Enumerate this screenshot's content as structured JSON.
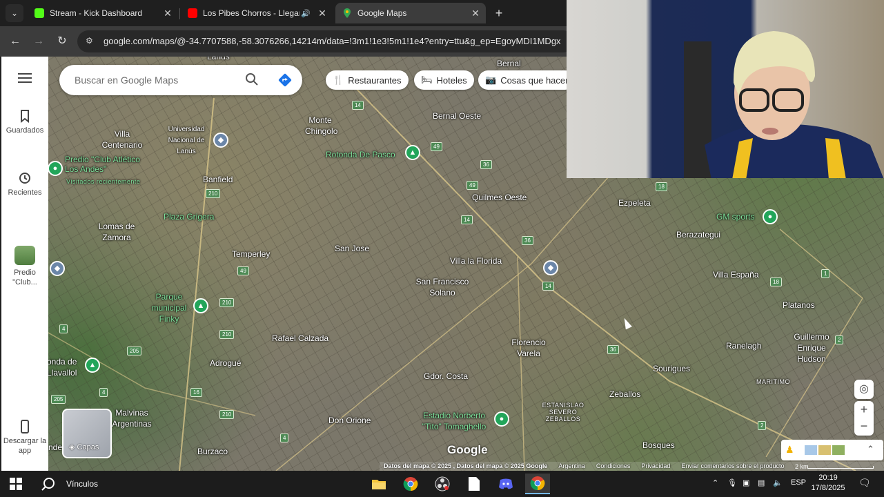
{
  "browser": {
    "tabs": [
      {
        "title": "Stream - Kick Dashboard",
        "favicon": "kick-icon",
        "color": "#53fc18",
        "active": false
      },
      {
        "title": "Los Pibes Chorros - Llegam",
        "favicon": "youtube-icon",
        "color": "#ff0000",
        "active": false
      },
      {
        "title": "Google Maps",
        "favicon": "google-maps-icon",
        "color": "#34a853",
        "active": true
      }
    ],
    "url": "google.com/maps/@-34.7707588,-58.3076266,14214m/data=!3m1!1e3!5m1!1e4?entry=ttu&g_ep=EgoyMDI1MDgx"
  },
  "rail": {
    "saved": "Guardados",
    "recent": "Recientes",
    "recent_place": "Predio \"Club...",
    "download": "Descargar la app"
  },
  "search": {
    "placeholder": "Buscar en Google Maps"
  },
  "chips": {
    "restaurants": "Restaurantes",
    "hotels": "Hoteles",
    "things": "Cosas que hacer"
  },
  "map": {
    "labels": {
      "lanus": "Lanús",
      "bernal": "Bernal",
      "monte_chingolo": "Monte Chingolo",
      "bernal_oeste": "Bernal Oeste",
      "villa_centenario": "Villa Centenario",
      "univ_lanus": "Universidad Nacional de Lanús",
      "predio": "Predio \"Club Atlético Los Andes\"",
      "visitados": "Visitados recientemente",
      "rotonda": "Rotonda De Pasco",
      "banfield": "Banfield",
      "quilmes_oeste": "Quilmes Oeste",
      "ezpeleta": "Ezpeleta",
      "gm_sports": "GM sports",
      "plaza_grigera": "Plaza Grigera",
      "berazategui": "Berazategui",
      "lomas": "Lomas de Zamora",
      "san_jose": "San Jose",
      "temperley": "Temperley",
      "villa_florida": "Villa la Florida",
      "villa_espana": "Villa España",
      "san_francisco": "San Francisco Solano",
      "platanos": "Platanos",
      "parque_finky": "Parque municipal Finky",
      "rafael_calzada": "Rafael Calzada",
      "florencio_varela": "Florencio Varela",
      "ranelagh": "Ranelagh",
      "guillermo_hudson": "Guillermo Enrique Hudson",
      "adrogue": "Adrogué",
      "sourigues": "Sourigues",
      "llavallol": "onda de Llavallol",
      "gdor_costa": "Gdor. Costa",
      "maritimo": "MARITIMO",
      "zeballos": "Zeballos",
      "estanislao": "ESTANISLAO SEVERO ZEBALLOS",
      "malvinas": "Malvinas Argentinas",
      "don_orione": "Don Orione",
      "estadio": "Estadio Norberto \"Tito\" Tomaghello",
      "bosques": "Bosques",
      "burzaco": "Burzaco",
      "nde": "nde",
      "ar": "Ar"
    },
    "routes": {
      "r14": "14",
      "r49": "49",
      "r36": "36",
      "r210": "210",
      "r18": "18",
      "r4": "4",
      "r205": "205",
      "r16": "16",
      "r1": "1",
      "r2": "2"
    },
    "layers": "Capas",
    "google": "Google",
    "footer": {
      "data": "Datos del mapa © 2025 , Datos del mapa © 2025 Google",
      "country": "Argentina",
      "terms": "Condiciones",
      "privacy": "Privacidad",
      "feedback": "Enviar comentarios sobre el producto"
    },
    "scale": "2 km"
  },
  "taskbar": {
    "search_label": "Vínculos",
    "lang": "ESP",
    "time": "20:19",
    "date": "17/8/2025"
  }
}
